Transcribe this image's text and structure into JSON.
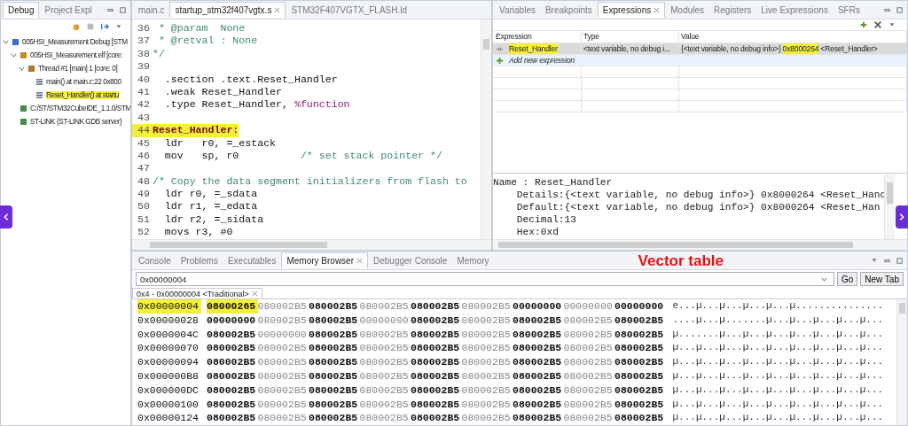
{
  "debug": {
    "tabs": [
      {
        "label": "Debug",
        "selected": true
      },
      {
        "label": "Project Expl",
        "selected": false
      }
    ],
    "tree": [
      {
        "label": "005HSI_Measurement Debug [STM",
        "kind": "launch",
        "expanded": true,
        "highlighted": false,
        "children": [
          {
            "label": "005HSI_Measurement.elf [core:",
            "kind": "process",
            "expanded": true,
            "highlighted": false,
            "children": [
              {
                "label": "Thread #1 [main] 1 [core: 0]",
                "kind": "thread",
                "expanded": true,
                "highlighted": false,
                "children": [
                  {
                    "label": "main() at main.c:22 0x800",
                    "kind": "frame",
                    "highlighted": false
                  },
                  {
                    "label": "Reset_Handler() at startu",
                    "kind": "frame",
                    "highlighted": true
                  }
                ]
              }
            ]
          },
          {
            "label": "C:/ST/STM32CubeIDE_1.1.0/STM",
            "kind": "path",
            "highlighted": false
          },
          {
            "label": "ST-LINK (ST-LINK GDB server)",
            "kind": "path",
            "highlighted": false
          }
        ]
      }
    ]
  },
  "editor": {
    "tabs": [
      {
        "label": "main.c",
        "selected": false
      },
      {
        "label": "startup_stm32f407vgtx.s",
        "selected": true
      },
      {
        "label": "STM32F407VGTX_FLASH.ld",
        "selected": false
      }
    ],
    "lines": [
      {
        "number": "36",
        "highlighted": false,
        "segments": [
          {
            "text": " * @param  None",
            "kind": "comment"
          }
        ]
      },
      {
        "number": "37",
        "highlighted": false,
        "segments": [
          {
            "text": " * @retval : None",
            "kind": "comment"
          }
        ]
      },
      {
        "number": "38",
        "highlighted": false,
        "segments": [
          {
            "text": "*/",
            "kind": "comment"
          }
        ]
      },
      {
        "number": "39",
        "highlighted": false
      },
      {
        "number": "40",
        "highlighted": false,
        "segments": [
          {
            "text": "  .section .text.Reset_Handler",
            "kind": "code"
          }
        ]
      },
      {
        "number": "41",
        "highlighted": false,
        "segments": [
          {
            "text": "  .weak Reset_Handler",
            "kind": "code"
          }
        ]
      },
      {
        "number": "42",
        "highlighted": false,
        "segments": [
          {
            "text": "  .type Reset_Handler, ",
            "kind": "code"
          },
          {
            "text": "%function",
            "kind": "keyword"
          }
        ]
      },
      {
        "number": "43",
        "highlighted": false
      },
      {
        "number": "44",
        "highlighted": true,
        "segments": [
          {
            "text": "Reset_Handler:",
            "kind": "label"
          }
        ]
      },
      {
        "number": "45",
        "highlighted": false,
        "segments": [
          {
            "text": "  ldr   r0, =_estack",
            "kind": "code"
          }
        ]
      },
      {
        "number": "46",
        "highlighted": false,
        "segments": [
          {
            "text": "  mov   sp, r0",
            "kind": "code"
          },
          {
            "text": "          /* set stack pointer */",
            "kind": "comment"
          }
        ]
      },
      {
        "number": "47",
        "highlighted": false
      },
      {
        "number": "48",
        "highlighted": false,
        "segments": [
          {
            "text": "/* Copy the data segment initializers from flash to",
            "kind": "comment"
          }
        ]
      },
      {
        "number": "49",
        "highlighted": false,
        "segments": [
          {
            "text": "  ldr r0, =_sdata",
            "kind": "code"
          }
        ]
      },
      {
        "number": "50",
        "highlighted": false,
        "segments": [
          {
            "text": "  ldr r1, =_edata",
            "kind": "code"
          }
        ]
      },
      {
        "number": "51",
        "highlighted": false,
        "segments": [
          {
            "text": "  ldr r2, =_sidata",
            "kind": "code"
          }
        ]
      },
      {
        "number": "52",
        "highlighted": false,
        "segments": [
          {
            "text": "  movs r3, #0",
            "kind": "code"
          }
        ]
      }
    ]
  },
  "expressions": {
    "tabs": [
      {
        "label": "Variables",
        "selected": false
      },
      {
        "label": "Breakpoints",
        "selected": false
      },
      {
        "label": "Expressions",
        "selected": true
      },
      {
        "label": "Modules",
        "selected": false
      },
      {
        "label": "Registers",
        "selected": false
      },
      {
        "label": "Live Expressions",
        "selected": false
      },
      {
        "label": "SFRs",
        "selected": false
      }
    ],
    "columns": [
      "Expression",
      "Type",
      "Value"
    ],
    "rows": [
      {
        "name": "Reset_Handler",
        "name_highlighted": true,
        "type": "<text variable, no debug i...",
        "selected": true,
        "value": [
          {
            "text": "{<text variable, no debug info>}",
            "highlighted": false
          },
          {
            "text": "0x8000264",
            "highlighted": true
          },
          {
            "text": "<Reset_Handler>",
            "highlighted": false
          }
        ]
      }
    ],
    "add_row": "Add new expression",
    "details": [
      "Name : Reset_Handler",
      "    Details:{<text variable, no debug info>} 0x8000264 <Reset_Hand",
      "    Default:{<text variable, no debug info>} 0x8000264 <Reset_Han",
      "    Decimal:13",
      "    Hex:0xd"
    ]
  },
  "memory": {
    "tabs": [
      {
        "label": "Console",
        "selected": false
      },
      {
        "label": "Problems",
        "selected": false
      },
      {
        "label": "Executables",
        "selected": false
      },
      {
        "label": "Memory Browser",
        "selected": true
      },
      {
        "label": "Debugger Console",
        "selected": false
      },
      {
        "label": "Memory",
        "selected": false
      }
    ],
    "address_field": "0x00000004",
    "buttons": [
      "Go",
      "New Tab"
    ],
    "rendering_tab": "0x4 - 0x00000004 <Traditional>",
    "rows": [
      {
        "address": "0x00000004",
        "highlighted": true,
        "words": [
          "08000265",
          "080002B5",
          "080002B5",
          "080002B5",
          "080002B5",
          "080002B5",
          "00000000",
          "00000000",
          "00000000"
        ],
        "ascii": "e...µ...µ...µ...µ...µ..............."
      },
      {
        "address": "0x00000028",
        "highlighted": false,
        "words": [
          "00000000",
          "080002B5",
          "080002B5",
          "00000000",
          "080002B5",
          "080002B5",
          "080002B5",
          "080002B5",
          "080002B5"
        ],
        "ascii": "....µ...µ.......µ...µ...µ...µ...µ..."
      },
      {
        "address": "0x0000004C",
        "highlighted": false,
        "words": [
          "080002B5",
          "00000000",
          "080002B5",
          "080002B5",
          "080002B5",
          "080002B5",
          "080002B5",
          "080002B5",
          "080002B5"
        ],
        "ascii": "µ.......µ...µ...µ...µ...µ...µ...µ..."
      },
      {
        "address": "0x00000070",
        "highlighted": false,
        "words": [
          "080002B5",
          "080002B5",
          "080002B5",
          "080002B5",
          "080002B5",
          "080002B5",
          "080002B5",
          "080002B5",
          "080002B5"
        ],
        "ascii": "µ...µ...µ...µ...µ...µ...µ...µ...µ..."
      },
      {
        "address": "0x00000094",
        "highlighted": false,
        "words": [
          "080002B5",
          "080002B5",
          "080002B5",
          "080002B5",
          "080002B5",
          "080002B5",
          "080002B5",
          "080002B5",
          "080002B5"
        ],
        "ascii": "µ...µ...µ...µ...µ...µ...µ...µ...µ..."
      },
      {
        "address": "0x000000B8",
        "highlighted": false,
        "words": [
          "080002B5",
          "080002B5",
          "080002B5",
          "080002B5",
          "080002B5",
          "080002B5",
          "080002B5",
          "080002B5",
          "080002B5"
        ],
        "ascii": "µ...µ...µ...µ...µ...µ...µ...µ...µ..."
      },
      {
        "address": "0x000000DC",
        "highlighted": false,
        "words": [
          "080002B5",
          "080002B5",
          "080002B5",
          "080002B5",
          "080002B5",
          "080002B5",
          "080002B5",
          "080002B5",
          "080002B5"
        ],
        "ascii": "µ...µ...µ...µ...µ...µ...µ...µ...µ..."
      },
      {
        "address": "0x00000100",
        "highlighted": false,
        "words": [
          "080002B5",
          "080002B5",
          "080002B5",
          "080002B5",
          "080002B5",
          "080002B5",
          "080002B5",
          "080002B5",
          "080002B5"
        ],
        "ascii": "µ...µ...µ...µ...µ...µ...µ...µ...µ..."
      },
      {
        "address": "0x00000124",
        "highlighted": false,
        "words": [
          "080002B5",
          "080002B5",
          "080002B5",
          "080002B5",
          "080002B5",
          "080002B5",
          "080002B5",
          "080002B5",
          "080002B5"
        ],
        "ascii": "µ...µ...µ...µ...µ...µ...µ...µ...µ..."
      }
    ],
    "annotation": "Vector table"
  }
}
